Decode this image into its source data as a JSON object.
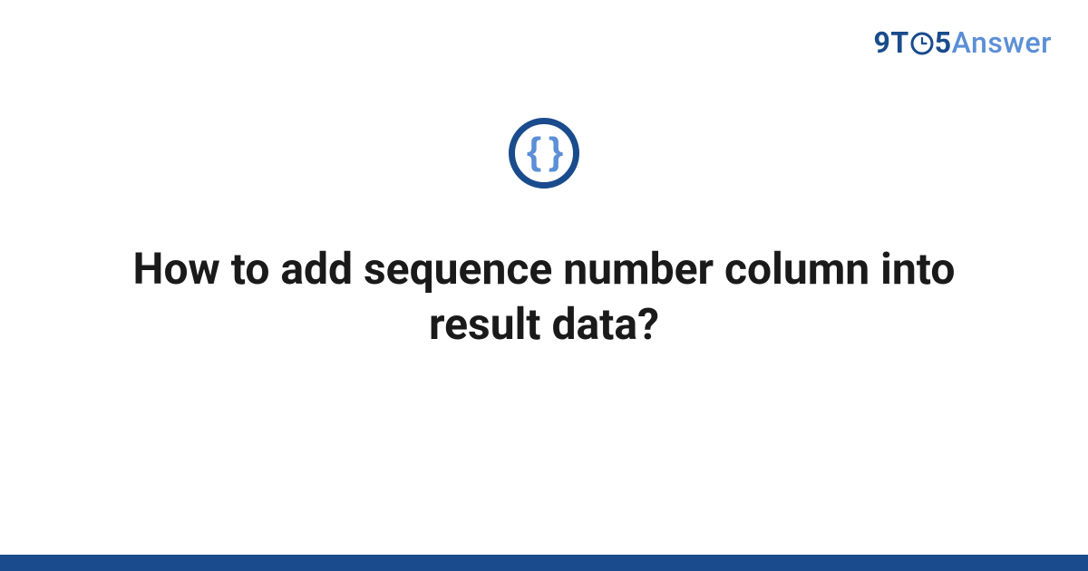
{
  "brand": {
    "part1": "9T",
    "part2": "5",
    "part3": "Answer"
  },
  "icon": {
    "glyph": "{ }",
    "name": "code-braces"
  },
  "title": "How to add sequence number column into result data?",
  "colors": {
    "primary": "#1a4b8c",
    "accent": "#5b8fd6",
    "text": "#1a1a1a",
    "background": "#ffffff"
  }
}
